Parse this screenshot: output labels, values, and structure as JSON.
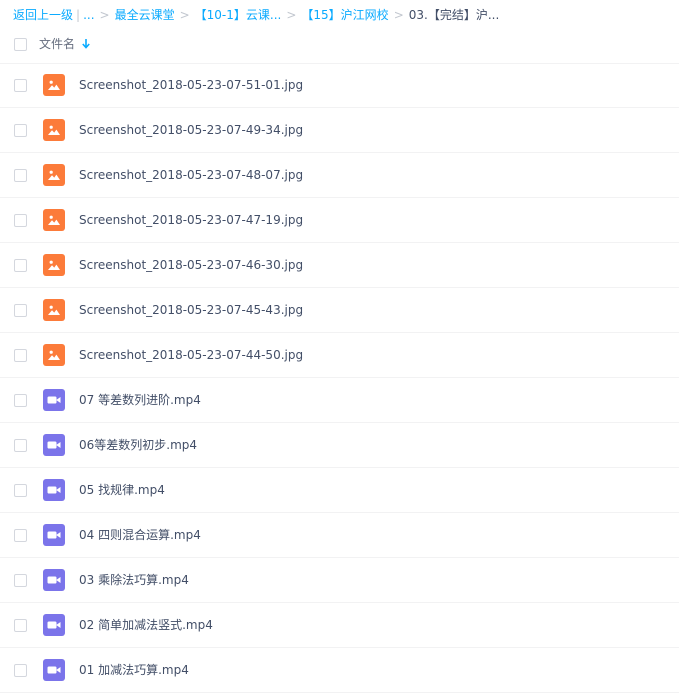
{
  "breadcrumb": {
    "back": "返回上一级",
    "ellipsis": "...",
    "items": [
      "最全云课堂",
      "【10-1】云课...",
      "【15】沪江网校"
    ],
    "current": "03.【完结】沪..."
  },
  "header": {
    "column_name": "文件名"
  },
  "colors": {
    "link": "#09aaff",
    "image_icon": "#fc7b3a",
    "video_icon": "#7b74ea"
  },
  "files": [
    {
      "name": "Screenshot_2018-05-23-07-51-01.jpg",
      "type": "image"
    },
    {
      "name": "Screenshot_2018-05-23-07-49-34.jpg",
      "type": "image"
    },
    {
      "name": "Screenshot_2018-05-23-07-48-07.jpg",
      "type": "image"
    },
    {
      "name": "Screenshot_2018-05-23-07-47-19.jpg",
      "type": "image"
    },
    {
      "name": "Screenshot_2018-05-23-07-46-30.jpg",
      "type": "image"
    },
    {
      "name": "Screenshot_2018-05-23-07-45-43.jpg",
      "type": "image"
    },
    {
      "name": "Screenshot_2018-05-23-07-44-50.jpg",
      "type": "image"
    },
    {
      "name": "07 等差数列进阶.mp4",
      "type": "video"
    },
    {
      "name": "06等差数列初步.mp4",
      "type": "video"
    },
    {
      "name": "05 找规律.mp4",
      "type": "video"
    },
    {
      "name": "04 四则混合运算.mp4",
      "type": "video"
    },
    {
      "name": "03 乘除法巧算.mp4",
      "type": "video"
    },
    {
      "name": "02 简单加减法竖式.mp4",
      "type": "video"
    },
    {
      "name": "01 加减法巧算.mp4",
      "type": "video"
    }
  ]
}
